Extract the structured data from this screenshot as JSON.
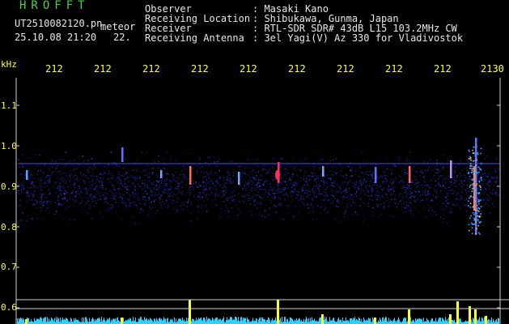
{
  "header": {
    "brand": "HROFFT",
    "filename": "UT2510082120.pn",
    "mode": "meteor",
    "datetime": "25.10.08 21:20",
    "frame": "22.",
    "info_labels": [
      "Observer",
      "Receiving Location",
      "Receiver",
      "Receiving Antenna"
    ],
    "info_values": [
      ": Masaki Kano",
      ": Shibukawa, Gunma, Japan",
      ": RTL-SDR SDR# 43dB L15 103.2MHz CW",
      ": 3el Yagi(V) Az 330 for Vladivostok"
    ]
  },
  "axes": {
    "y_unit": "kHz",
    "y_ticks": [
      "1.1",
      "1.0",
      "0.9",
      "0.8",
      "0.7",
      "0.6"
    ],
    "x_ticks": [
      "212",
      "212",
      "212",
      "212",
      "212",
      "212",
      "212",
      "212",
      "212",
      "2130"
    ]
  },
  "colors": {
    "background": "#000000",
    "axis_text": "#ffff40",
    "brand": "#4cd04c",
    "header_text": "#e8e8e8",
    "noise": "#2a2ab0",
    "echo_hot": "#ff3060",
    "bar_fill": "#ffff30",
    "bar_base": "#30d0ff"
  }
}
